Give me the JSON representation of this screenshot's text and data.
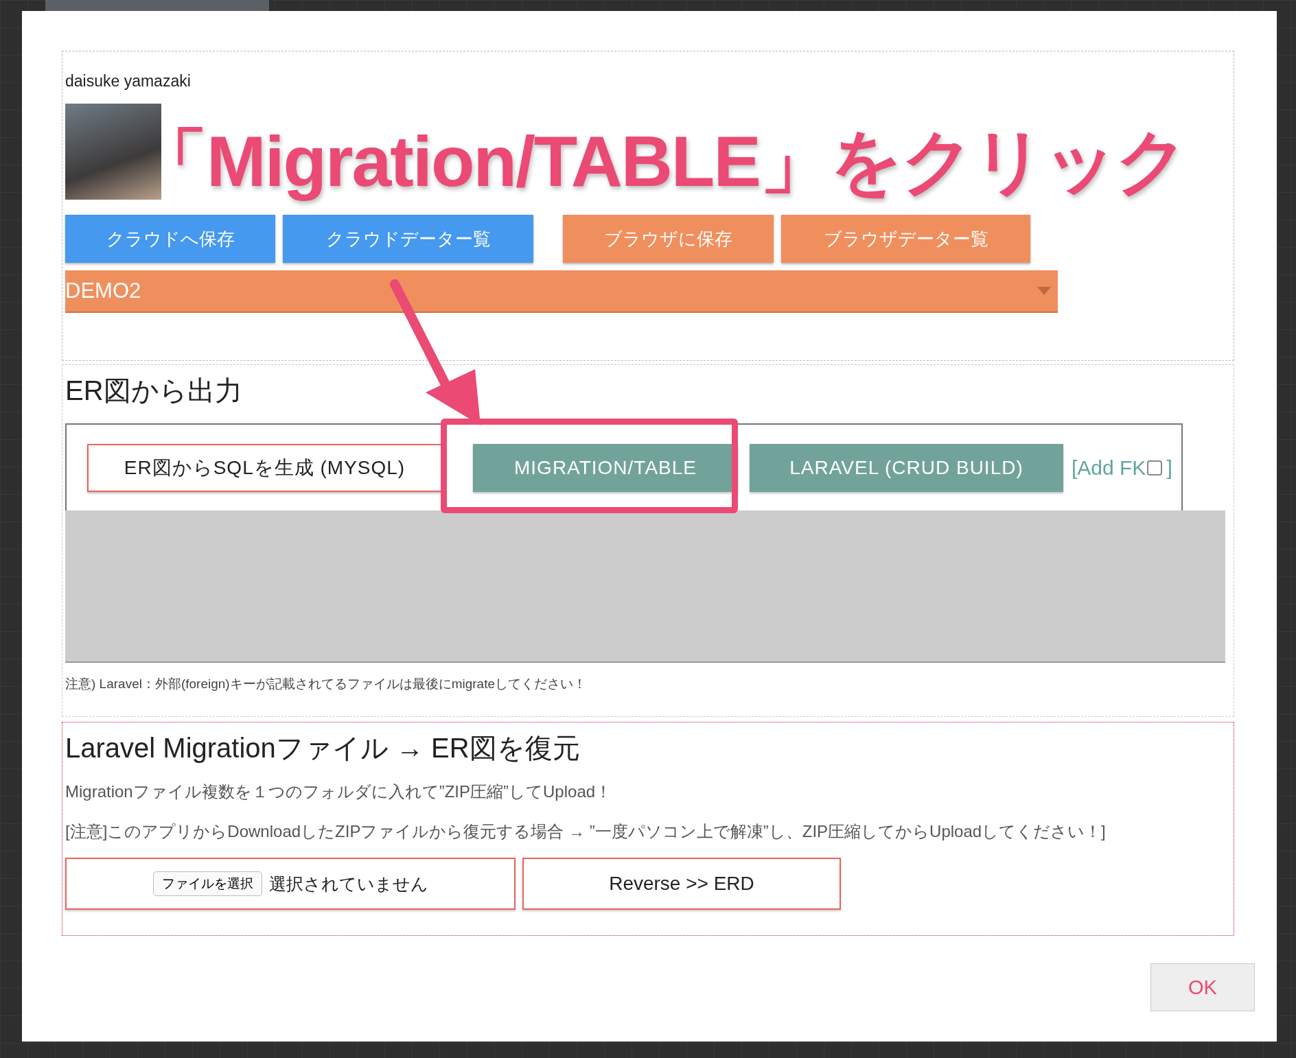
{
  "annotation": {
    "text": "「Migration/TABLE」をクリック"
  },
  "profile": {
    "name": "daisuke yamazaki"
  },
  "storage_buttons": [
    {
      "label": "クラウドへ保存",
      "kind": "cloud"
    },
    {
      "label": "クラウドデーター覧",
      "kind": "cloud"
    },
    {
      "label": "ブラウザに保存",
      "kind": "browser"
    },
    {
      "label": "ブラウザデーター覧",
      "kind": "browser"
    }
  ],
  "dropdown": {
    "value": "DEMO2"
  },
  "export": {
    "title": "ER図から出力",
    "buttons": [
      {
        "label": "ER図からSQLを生成 (MYSQL)",
        "kind": "outline"
      },
      {
        "label": "MIGRATION/TABLE",
        "kind": "teal"
      },
      {
        "label": "LARAVEL (CRUD BUILD)",
        "kind": "teal"
      }
    ],
    "add_fk": {
      "open": "[Add FK",
      "close": "]",
      "checked": false
    },
    "note": "注意) Laravel：外部(foreign)キーが記載されてるファイルは最後にmigrateしてください！"
  },
  "restore": {
    "title": "Laravel Migrationファイル → ER図を復元",
    "paragraphs": [
      "Migrationファイル複数を１つのフォルダに入れて”ZIP圧縮”してUpload！",
      "[注意]このアプリからDownloadしたZIPファイルから復元する場合 → ”一度パソコン上で解凍”し、ZIP圧縮してからUploadしてください！]"
    ],
    "file_button": "ファイルを選択",
    "file_status": "選択されていません",
    "reverse_button": "Reverse >> ERD"
  },
  "ok_button": "OK"
}
